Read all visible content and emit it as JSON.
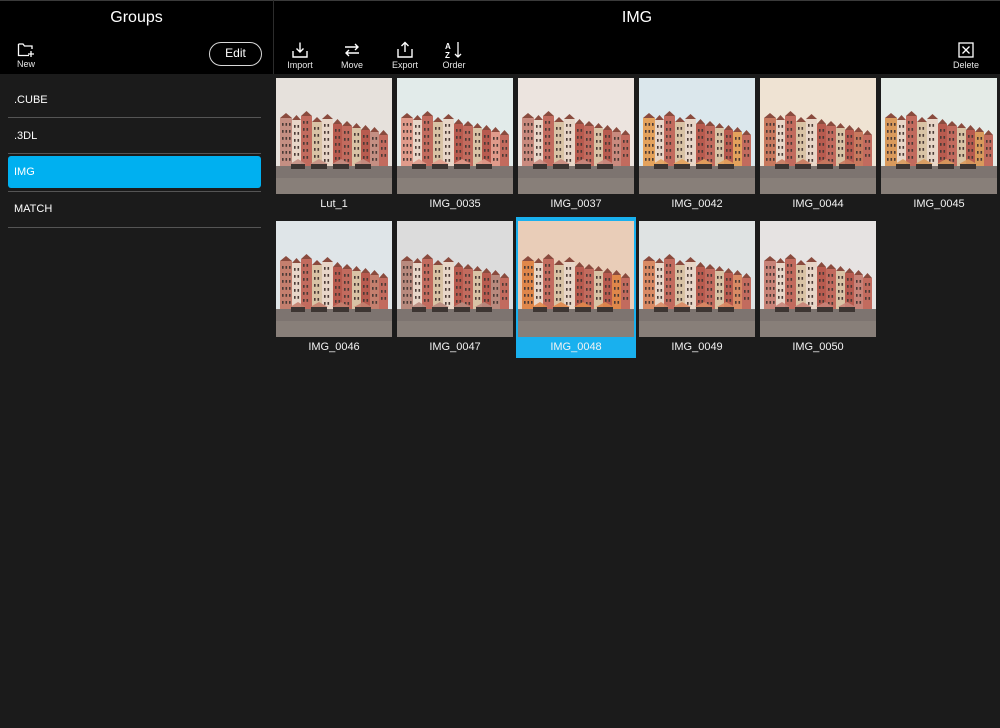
{
  "groups_panel": {
    "title": "Groups",
    "new_label": "New",
    "edit_label": "Edit",
    "items": [
      {
        "label": ".CUBE",
        "selected": false
      },
      {
        "label": ".3DL",
        "selected": false
      },
      {
        "label": "IMG",
        "selected": true
      },
      {
        "label": "MATCH",
        "selected": false
      }
    ]
  },
  "content_panel": {
    "title": "IMG",
    "toolbar": {
      "import_label": "Import",
      "move_label": "Move",
      "export_label": "Export",
      "order_label": "Order",
      "delete_label": "Delete"
    },
    "thumbnails": [
      {
        "label": "Lut_1",
        "selected": false,
        "sky": "#e6e1dc",
        "tint": "#c48f83"
      },
      {
        "label": "IMG_0035",
        "selected": false,
        "sky": "#e2ebea",
        "tint": "#e09b8b"
      },
      {
        "label": "IMG_0037",
        "selected": false,
        "sky": "#ece4df",
        "tint": "#c98a7e"
      },
      {
        "label": "IMG_0042",
        "selected": false,
        "sky": "#dbe7ec",
        "tint": "#e4a25c"
      },
      {
        "label": "IMG_0044",
        "selected": false,
        "sky": "#efe3d3",
        "tint": "#c8795e"
      },
      {
        "label": "IMG_0045",
        "selected": false,
        "sky": "#e4ebe7",
        "tint": "#d99a5c"
      },
      {
        "label": "IMG_0046",
        "selected": false,
        "sky": "#dfe5e8",
        "tint": "#c47f6e"
      },
      {
        "label": "IMG_0047",
        "selected": false,
        "sky": "#dcdcdc",
        "tint": "#b88a7e"
      },
      {
        "label": "IMG_0048",
        "selected": true,
        "sky": "#e9cdb8",
        "tint": "#e0874a"
      },
      {
        "label": "IMG_0049",
        "selected": false,
        "sky": "#dfe3e3",
        "tint": "#d98a64"
      },
      {
        "label": "IMG_0050",
        "selected": false,
        "sky": "#e6e3e2",
        "tint": "#c88378"
      }
    ]
  },
  "colors": {
    "accent": "#00b0f0",
    "background": "#1b1b1b",
    "bar": "#000000"
  }
}
